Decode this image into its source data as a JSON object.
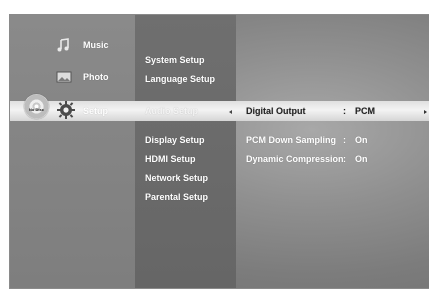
{
  "left_menu": {
    "items": [
      {
        "label": "Music",
        "icon": "music-note-icon"
      },
      {
        "label": "Photo",
        "icon": "photo-icon"
      },
      {
        "label": "Setup",
        "icon": "gear-icon"
      }
    ],
    "disc_label": "No Disc"
  },
  "setup_menu": {
    "items": [
      "System Setup",
      "Language Setup",
      "Audio Setup",
      "Display Setup",
      "HDMI Setup",
      "Network Setup",
      "Parental Setup"
    ],
    "selected_index": 2
  },
  "audio_setup": {
    "rows": [
      {
        "label": "Digital Output",
        "separator": ":",
        "value": "PCM"
      },
      {
        "label": "PCM Down Sampling",
        "separator": ":",
        "value": "On"
      },
      {
        "label": "Dynamic Compression",
        "separator": ":",
        "value": "On"
      }
    ]
  }
}
